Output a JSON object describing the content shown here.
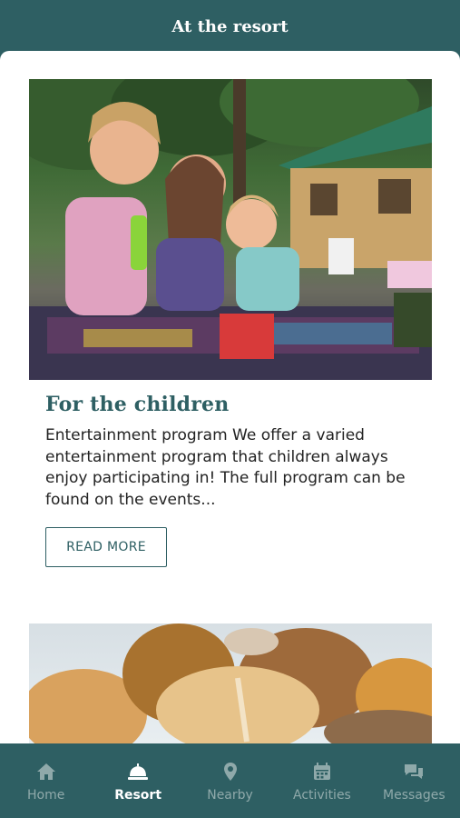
{
  "header": {
    "title": "At the resort"
  },
  "cards": [
    {
      "title": "For the children",
      "text": "Entertainment program We offer a varied entertainment program that children always enjoy participating in! The full program can be found on the events...",
      "button": "READ MORE"
    }
  ],
  "tabs": [
    {
      "label": "Home",
      "icon": "home-icon"
    },
    {
      "label": "Resort",
      "icon": "bell-icon",
      "active": true
    },
    {
      "label": "Nearby",
      "icon": "map-pin-icon"
    },
    {
      "label": "Activities",
      "icon": "calendar-icon"
    },
    {
      "label": "Messages",
      "icon": "chat-icon"
    }
  ],
  "colors": {
    "brand": "#2e5f63",
    "inactive_tab": "#8fa9aa"
  }
}
